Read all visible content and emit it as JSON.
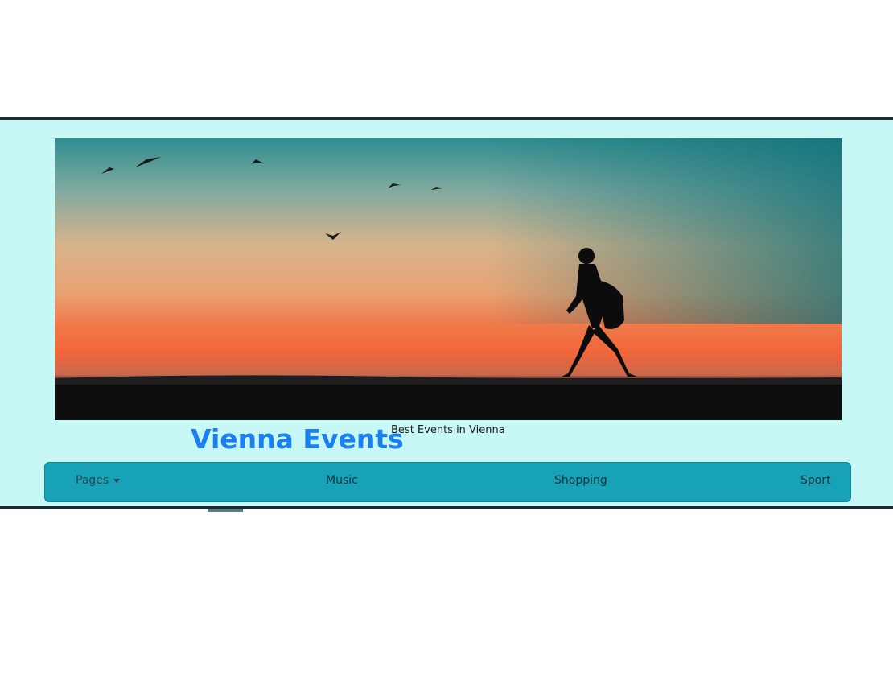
{
  "brand": {
    "title": "Vienna Events",
    "tagline": "Best Events in Vienna"
  },
  "hero": {
    "icon": "sunset-hiker-banner"
  },
  "nav": {
    "items": [
      {
        "label": "Pages"
      },
      {
        "label": "Music"
      },
      {
        "label": "Shopping"
      },
      {
        "label": "Sport"
      }
    ]
  },
  "colors": {
    "header_bg": "#c8f8f6",
    "brand_blue": "#1a7ff0",
    "navbar_bg": "#17a2b8"
  }
}
